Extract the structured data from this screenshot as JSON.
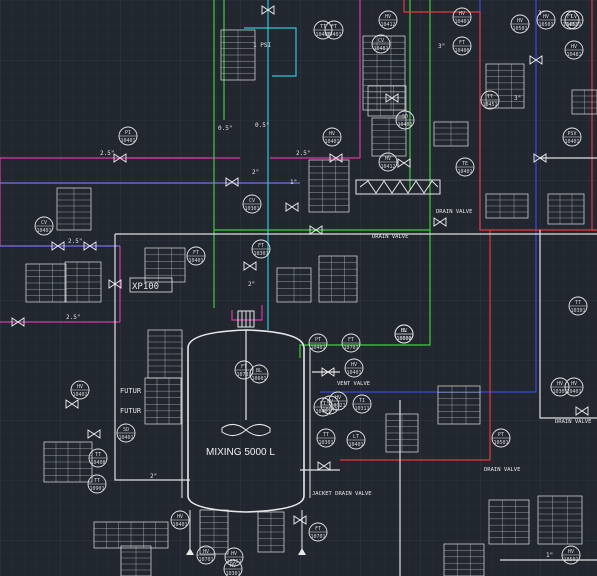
{
  "vessel": {
    "label": "MIXING 5000 L"
  },
  "labels": {
    "fps": "1 PSI",
    "vent_valve": "VENT VALVE",
    "drain_valve_1": "DRAIN VALVE",
    "drain_valve_2": "DRAIN VALVE",
    "drain_valve_3": "DRAIN VALVE",
    "drain_valve_4": "DRAIN VALVE",
    "jacket_drain_valve": "JACKET DRAIN VALVE",
    "future_1": "FUTUR",
    "future_2": "FUTUR",
    "xp_box": "XP100"
  },
  "pipe_sizes": [
    "2.5\"",
    "2.5\"",
    "2.5\"",
    "2.5\"",
    "2\"",
    "2\"",
    "3\"",
    "3\"",
    "3\"",
    "0.5\"",
    "0.5\"",
    "2\"",
    "1\"",
    "1\""
  ],
  "instruments": [
    {
      "tag": "PI",
      "num": "10401"
    },
    {
      "tag": "CV",
      "num": "10401"
    },
    {
      "tag": "HV",
      "num": "10412"
    },
    {
      "tag": "HV",
      "num": "10401"
    },
    {
      "tag": "LV",
      "num": "10501"
    },
    {
      "tag": "CV",
      "num": "10481"
    },
    {
      "tag": "FT",
      "num": "10400"
    },
    {
      "tag": "HV",
      "num": "10481"
    },
    {
      "tag": "CV",
      "num": "10301"
    },
    {
      "tag": "FT",
      "num": "10301"
    },
    {
      "tag": "HV",
      "num": "10401"
    },
    {
      "tag": "TE",
      "num": "10401"
    },
    {
      "tag": "PSV",
      "num": "10401"
    },
    {
      "tag": "HV",
      "num": "10412"
    },
    {
      "tag": "TT",
      "num": "10301"
    },
    {
      "tag": "HV",
      "num": "10300"
    },
    {
      "tag": "PT",
      "num": "10401"
    },
    {
      "tag": "FT",
      "num": "10701"
    },
    {
      "tag": "FT",
      "num": "10781"
    },
    {
      "tag": "BL",
      "num": "10601"
    },
    {
      "tag": "BL",
      "num": "10602"
    },
    {
      "tag": "SD",
      "num": "10401"
    },
    {
      "tag": "TT",
      "num": "10408"
    },
    {
      "tag": "HV",
      "num": "10401"
    },
    {
      "tag": "HV",
      "num": "10401"
    },
    {
      "tag": "HV",
      "num": "10321"
    },
    {
      "tag": "TI",
      "num": "10311"
    },
    {
      "tag": "TT",
      "num": "10301"
    },
    {
      "tag": "PT",
      "num": "10501"
    },
    {
      "tag": "FT",
      "num": "10701"
    },
    {
      "tag": "HV",
      "num": "10301"
    },
    {
      "tag": "TT",
      "num": "10901"
    },
    {
      "tag": "HV",
      "num": "10401"
    },
    {
      "tag": "HV",
      "num": "10501"
    },
    {
      "tag": "HV",
      "num": "10701"
    },
    {
      "tag": "HV",
      "num": "10361"
    },
    {
      "tag": "TT",
      "num": "10406"
    },
    {
      "tag": "HV",
      "num": "10641"
    },
    {
      "tag": "FT",
      "num": "10401"
    },
    {
      "tag": "FT",
      "num": "10461"
    },
    {
      "tag": "HV",
      "num": "10501"
    },
    {
      "tag": "FT",
      "num": "10401"
    },
    {
      "tag": "SD",
      "num": "10401"
    },
    {
      "tag": "TT",
      "num": "10451"
    },
    {
      "tag": "HV",
      "num": "10401"
    },
    {
      "tag": "LT",
      "num": "10401"
    },
    {
      "tag": "HV",
      "num": "10301"
    },
    {
      "tag": "FT",
      "num": "10401"
    },
    {
      "tag": "HV",
      "num": "10501"
    }
  ]
}
